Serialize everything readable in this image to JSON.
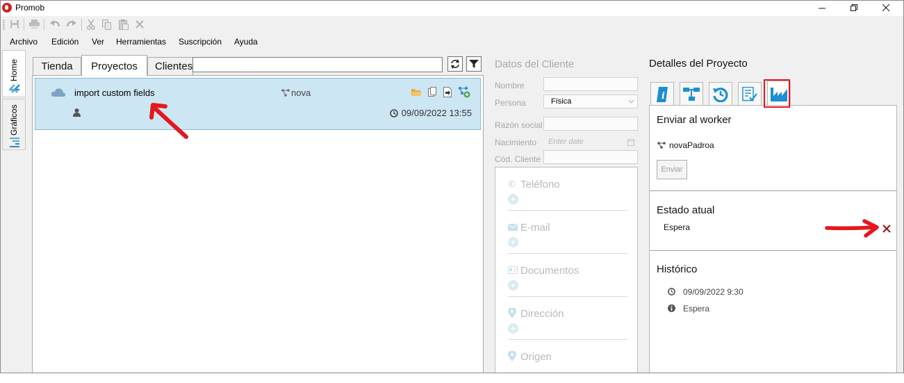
{
  "window": {
    "title": "Promob",
    "controls": [
      "minimize",
      "restore",
      "close"
    ]
  },
  "toolbar": {
    "icons": [
      "save-icon",
      "print-icon",
      "undo-icon",
      "redo-icon",
      "cut-icon",
      "copy-icon",
      "paste-icon",
      "delete-icon"
    ]
  },
  "menu": {
    "items": [
      "Archivo",
      "Edición",
      "Ver",
      "Herramientas",
      "Suscripción",
      "Ayuda"
    ]
  },
  "sidebar": {
    "tabs": [
      "Home",
      "Gráficos"
    ]
  },
  "projects": {
    "tabs": [
      "Tienda",
      "Proyectos",
      "Clientes"
    ],
    "active_tab": "Proyectos",
    "search_value": "",
    "items": [
      {
        "name": "import custom fields",
        "branch": "nova",
        "date": "09/09/2022 13:55"
      }
    ]
  },
  "client": {
    "title": "Datos del Cliente",
    "fields": {
      "nombre_label": "Nombre",
      "persona_label": "Persona",
      "persona_value": "Física",
      "razon_label": "Razón social",
      "nacimiento_label": "Nacimiento",
      "nacimiento_placeholder": "Enter date",
      "cod_label": "Cód. Cliente"
    },
    "contacts": [
      "Teléfono",
      "E-mail",
      "Documentos",
      "Dirección",
      "Origen"
    ]
  },
  "details": {
    "title": "Detalles del Proyecto",
    "tabs": [
      "info-icon",
      "hierarchy-icon",
      "history-icon",
      "checklist-icon",
      "factory-icon"
    ],
    "send": {
      "title": "Enviar al worker",
      "worker": "novaPadroa",
      "button": "Enviar"
    },
    "status": {
      "title": "Estado atual",
      "value": "Espera"
    },
    "history": {
      "title": "Histórico",
      "date": "09/09/2022 9:30",
      "state": "Espera"
    }
  },
  "colors": {
    "selection_bg": "#cde6f3",
    "accent_blue": "#1a8fd1",
    "annotation_red": "#e6161d",
    "disabled_text": "#a9a9a9"
  }
}
